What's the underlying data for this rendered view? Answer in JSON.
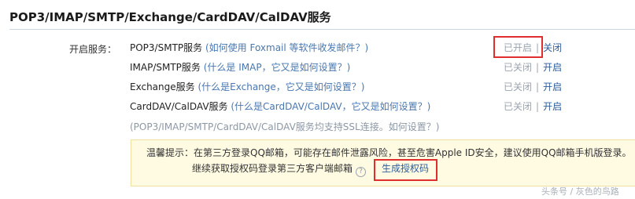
{
  "section": {
    "title": "POP3/IMAP/SMTP/Exchange/CardDAV/CalDAV服务",
    "open_services_label": "开启服务："
  },
  "services": [
    {
      "name": "POP3/SMTP服务",
      "help": "(如何使用 Foxmail 等软件收发邮件？)",
      "status": "已开启",
      "action": "关闭"
    },
    {
      "name": "IMAP/SMTP服务",
      "help": "(什么是 IMAP，它又是如何设置？)",
      "status": "已关闭",
      "action": "开启"
    },
    {
      "name": "Exchange服务",
      "help": "(什么是Exchange，它又是如何设置？)",
      "status": "已关闭",
      "action": "开启"
    },
    {
      "name": "CardDAV/CalDAV服务",
      "help": "(什么是CardDAV/CalDAV，它又是如何设置？)",
      "status": "已关闭",
      "action": "开启"
    }
  ],
  "separator": "|",
  "ssl_note": "(POP3/IMAP/SMTP/CardDAV/CalDAV服务均支持SSL连接。如何设置？)",
  "warning": {
    "line1": "温馨提示：在第三方登录QQ邮箱，可能存在邮件泄露风险，甚至危害Apple ID安全，建议使用QQ邮箱手机版登录。",
    "line2": "继续获取授权码登录第三方客户端邮箱",
    "help_icon_glyph": "?",
    "link": "生成授权码"
  },
  "watermark": "头条号 / 灰色的鸟路",
  "colors": {
    "link": "#2f5d9b",
    "help_text": "#4877b2",
    "status_gray": "#9aa4af",
    "highlight_red": "#e02d2d",
    "warning_bg": "#fffbe3"
  },
  "icons": {
    "help": "question-circle-icon"
  }
}
